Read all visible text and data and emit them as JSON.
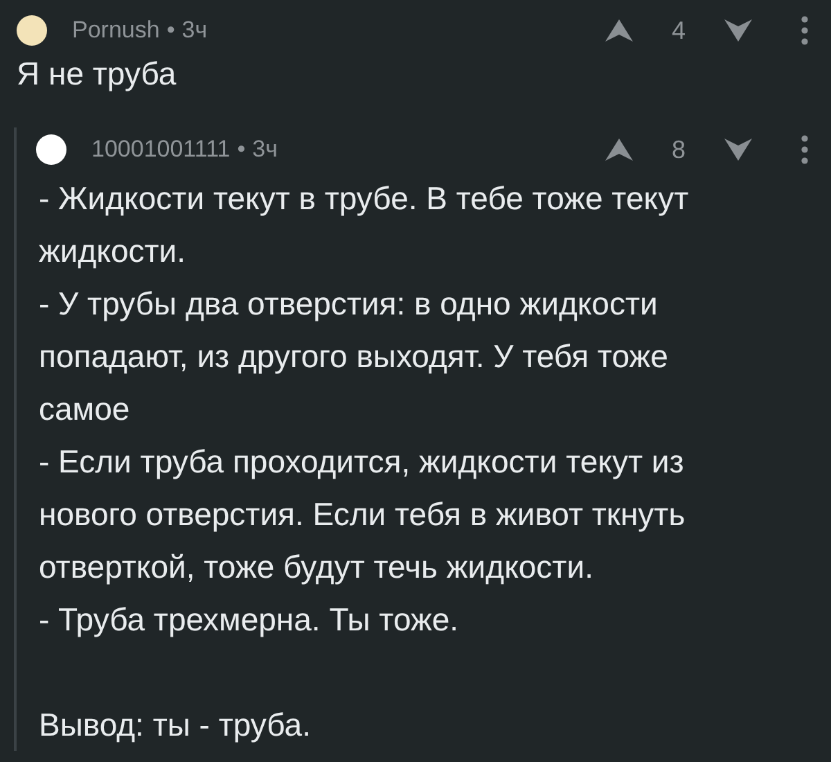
{
  "comments": [
    {
      "author": "Pornush",
      "separator": "•",
      "time": "3ч",
      "score": "4",
      "color": "#f3e3b8",
      "paragraphs": [
        {
          "kind": "plain",
          "text": "Я не труба"
        }
      ],
      "replies": [
        {
          "author": "10001001111",
          "separator": "•",
          "time": "3ч",
          "score": "8",
          "color": "#ffffff",
          "paragraphs": [
            {
              "kind": "plain",
              "text": "- Жидкости текут в трубе. В тебе тоже текут жидкости."
            },
            {
              "kind": "plain",
              "text": "- У трубы два отверстия: в одно жидкости попадают, из другого выходят. У тебя тоже самое"
            },
            {
              "kind": "plain",
              "text": "- Если труба проходится, жидкости текут из нового отверстия. Если тебя в живот ткнуть отверткой, тоже будут течь жидкости."
            },
            {
              "kind": "plain",
              "text": "- Труба трехмерна. Ты тоже."
            },
            {
              "kind": "conclusion",
              "text": "Вывод: ты - труба."
            }
          ]
        }
      ]
    }
  ]
}
